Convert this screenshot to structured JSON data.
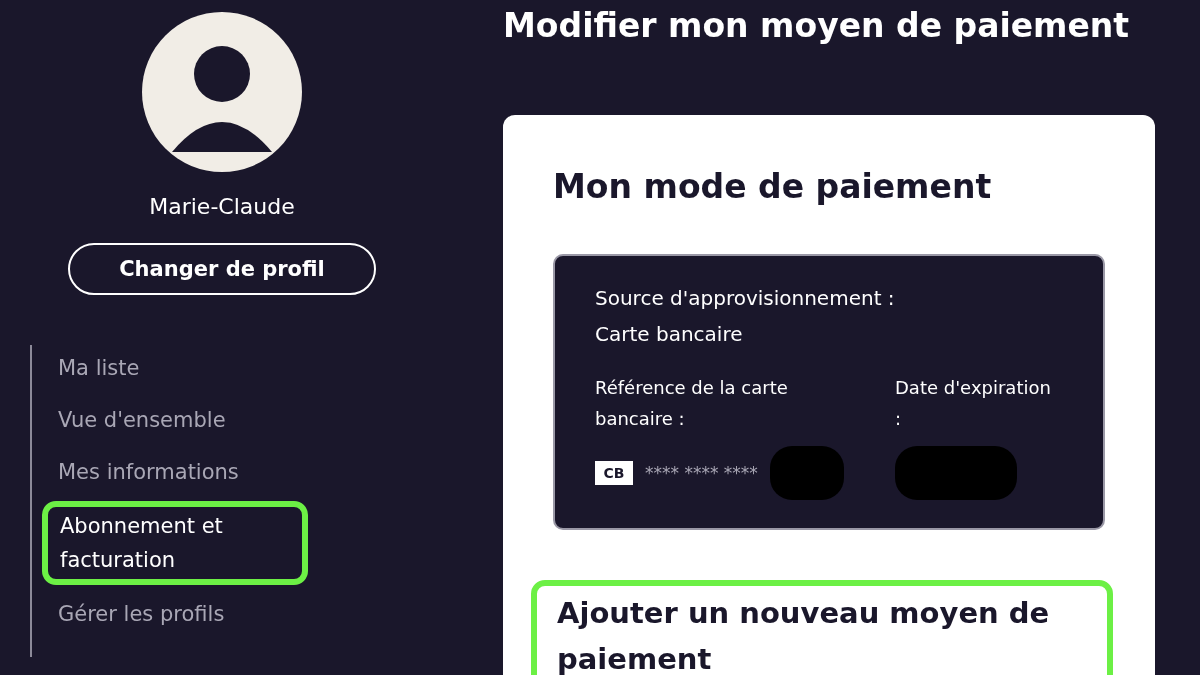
{
  "profile": {
    "name": "Marie-Claude",
    "switch_button": "Changer de profil"
  },
  "nav": [
    {
      "label": "Ma liste",
      "selected": false
    },
    {
      "label": "Vue d'ensemble",
      "selected": false
    },
    {
      "label": "Mes informations",
      "selected": false
    },
    {
      "label": "Abonnement et facturation",
      "selected": true
    },
    {
      "label": "Gérer les profils",
      "selected": false
    }
  ],
  "page_title": "Modifier mon moyen de paiement",
  "payment": {
    "title": "Mon mode de paiement",
    "source_label": "Source d'approvisionnement :",
    "source_value": "Carte bancaire",
    "card_ref_label": "Référence de la carte bancaire :",
    "card_logo": "CB",
    "card_number": "**** **** ****",
    "expiry_label": "Date d'expiration :"
  },
  "add_method": {
    "title": "Ajouter un nouveau moyen de paiement",
    "highlighted": true
  }
}
